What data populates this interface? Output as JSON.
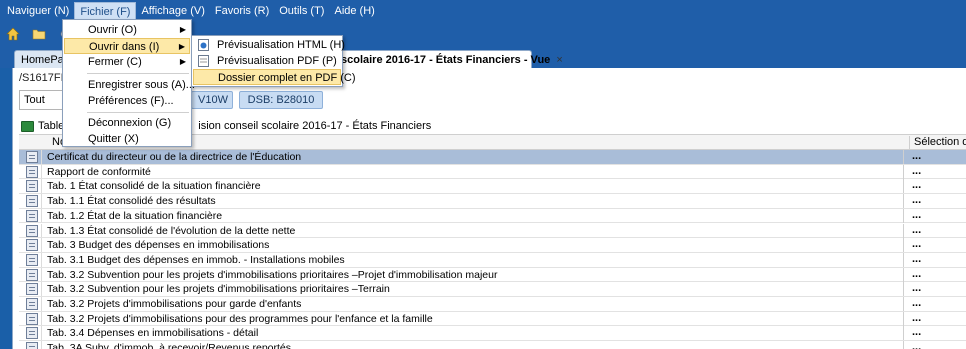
{
  "menubar": {
    "items": [
      "Naviguer (N)",
      "Fichier (F)",
      "Affichage (V)",
      "Favoris (R)",
      "Outils (T)",
      "Aide (H)"
    ]
  },
  "toolbar": {
    "icons": [
      "home-icon",
      "folder-icon",
      "tool-icon"
    ]
  },
  "tabs": {
    "home_label": "HomePage",
    "active_label": "scolaire 2016-17 - États Financiers - Vue",
    "close_glyph": "×"
  },
  "panel": {
    "path": "/S1617FIS/",
    "filter_value": "Tout",
    "pill_v10w": "V10W",
    "pill_dsb": "DSB: B28010",
    "table_title_prefix": "Table",
    "table_title_suffix": "ision conseil scolaire 2016-17 - États Financiers"
  },
  "grid": {
    "header_name": "No",
    "header_selection": "Sélection de m",
    "rows": [
      {
        "label": "Certificat du directeur ou de la directrice de l'Éducation",
        "sel": "...",
        "selected": true
      },
      {
        "label": "Rapport de conformité",
        "sel": "..."
      },
      {
        "label": "Tab. 1 État consolidé de la situation financière",
        "sel": "..."
      },
      {
        "label": "Tab. 1.1 État consolidé des résultats",
        "sel": "..."
      },
      {
        "label": "Tab. 1.2 État de la situation financière",
        "sel": "..."
      },
      {
        "label": "Tab. 1.3 État consolidé de l'évolution de la dette nette",
        "sel": "..."
      },
      {
        "label": "Tab. 3 Budget des dépenses en immobilisations",
        "sel": "..."
      },
      {
        "label": "Tab. 3.1 Budget des dépenses en immob. - Installations mobiles",
        "sel": "..."
      },
      {
        "label": "Tab. 3.2 Subvention pour les projets d'immobilisations prioritaires –Projet d'immobilisation majeur",
        "sel": "..."
      },
      {
        "label": "Tab. 3.2 Subvention pour les projets d'immobilisations prioritaires –Terrain",
        "sel": "..."
      },
      {
        "label": "Tab. 3.2 Projets d'immobilisations pour garde d'enfants",
        "sel": "..."
      },
      {
        "label": "Tab. 3.2 Projets d'immobilisations pour des programmes pour l'enfance et la famille",
        "sel": "..."
      },
      {
        "label": "Tab. 3.4 Dépenses en immobilisations - détail",
        "sel": "..."
      },
      {
        "label": "Tab. 3A Subv. d'immob. à recevoir/Revenus reportés",
        "sel": "..."
      }
    ]
  },
  "fichier_menu": {
    "items": [
      {
        "label": "Ouvrir (O)",
        "submenu": true
      },
      {
        "label": "Ouvrir dans (I)",
        "submenu": true,
        "highlighted": true
      },
      {
        "label": "Fermer (C)",
        "submenu": true
      },
      {
        "label": "Enregistrer sous (A)..."
      },
      {
        "label": "Préférences (F)..."
      },
      {
        "label": "Déconnexion (G)"
      },
      {
        "label": "Quitter (X)"
      }
    ]
  },
  "ouvrir_dans_submenu": {
    "items": [
      {
        "label": "Prévisualisation HTML (H)",
        "icon": "html-preview-icon"
      },
      {
        "label": "Prévisualisation PDF (P)",
        "icon": "pdf-preview-icon"
      },
      {
        "label": "Dossier complet en PDF (C)",
        "icon": "",
        "highlighted": true
      }
    ]
  },
  "colors": {
    "menubar_bg": "#1f5ea9",
    "selected_row": "#a9bdd8",
    "menu_highlight": "#fde9a8"
  }
}
